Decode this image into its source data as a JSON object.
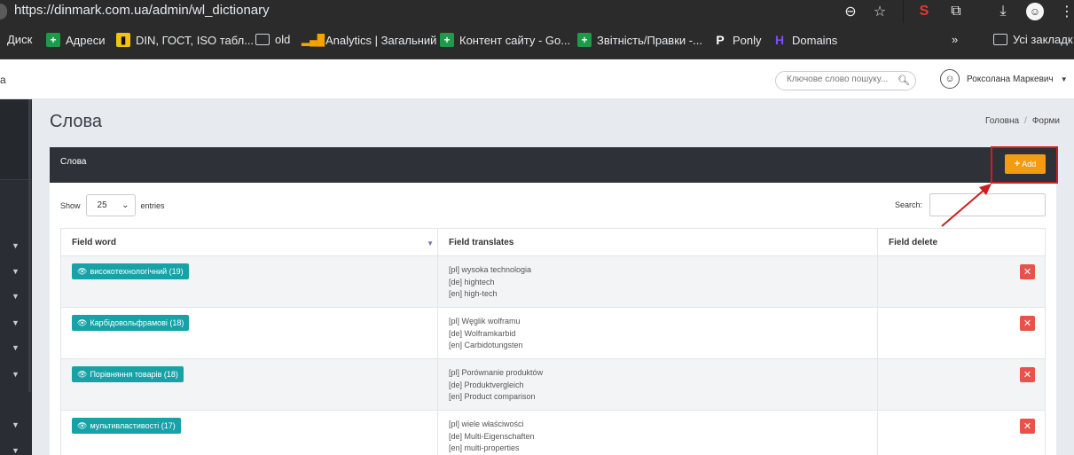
{
  "browser": {
    "url": "https://dinmark.com.ua/admin/wl_dictionary",
    "bookmarks": [
      {
        "label": "Диск",
        "icon": "drive-icon"
      },
      {
        "label": "Адреси",
        "icon": "sheets-icon"
      },
      {
        "label": "DIN, ГОСТ, ISO табл...",
        "icon": "yellow-icon"
      },
      {
        "label": "old",
        "icon": "folder-icon"
      },
      {
        "label": "Analytics | Загальний",
        "icon": "analytics-icon"
      },
      {
        "label": "Контент сайту - Go...",
        "icon": "sheets-icon"
      },
      {
        "label": "Звітність/Правки -...",
        "icon": "sheets-icon"
      },
      {
        "label": "Ponly",
        "icon": "ponly-icon"
      },
      {
        "label": "Domains",
        "icon": "domains-icon"
      },
      {
        "label": "Усі закладк",
        "icon": "folder-icon"
      }
    ],
    "more_glyph": "»"
  },
  "header": {
    "brand_fragment": "а",
    "search_placeholder": "Ключове слово пошуку...",
    "user_name": "Роксолана Маркевич"
  },
  "page": {
    "title": "Слова",
    "breadcrumb": [
      "Головна",
      "Форми"
    ]
  },
  "panel": {
    "title": "Слова",
    "add_label": "Add",
    "show_label": "Show",
    "entries_value": "25",
    "entries_label": "entries",
    "search_label": "Search:"
  },
  "table": {
    "columns": [
      "Field word",
      "Field translates",
      "Field delete"
    ],
    "rows": [
      {
        "word": "високотехнологічний (19)",
        "translates": [
          "[pl] wysoka technologia",
          "[de] hightech",
          "[en] high-tech"
        ]
      },
      {
        "word": "Карбідовольфрамові (18)",
        "translates": [
          "[pl] Węglik wolframu",
          "[de] Wolframkarbid",
          "[en] Carbidotungsten"
        ]
      },
      {
        "word": "Порівняння товарів (18)",
        "translates": [
          "[pl] Porównanie produktów",
          "[de] Produktvergleich",
          "[en] Product comparison"
        ]
      },
      {
        "word": "мультивластивості (17)",
        "translates": [
          "[pl] wiele właściwości",
          "[de] Multi-Eigenschaften",
          "[en] multi-properties"
        ]
      }
    ]
  },
  "colors": {
    "accent_orange": "#f39c12",
    "badge_teal": "#17a2a8",
    "delete_red": "#e9524a",
    "annotation_red": "#cc1f1f"
  }
}
